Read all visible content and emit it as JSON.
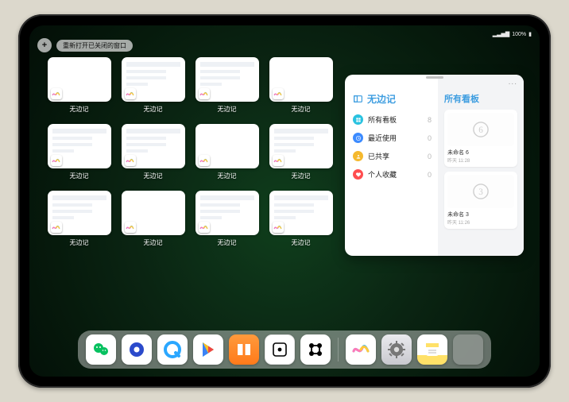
{
  "status": {
    "battery": "100%",
    "signal": "▂▃▅▇"
  },
  "top": {
    "add_label": "+",
    "reopen_label": "重新打开已关闭的窗口"
  },
  "switcher": {
    "app_name": "无边记",
    "cards": [
      {
        "label": "无边记",
        "style": "blank"
      },
      {
        "label": "无边记",
        "style": "detail"
      },
      {
        "label": "无边记",
        "style": "detail"
      },
      {
        "label": "无边记",
        "style": "blank"
      },
      {
        "label": "无边记",
        "style": "detail"
      },
      {
        "label": "无边记",
        "style": "detail"
      },
      {
        "label": "无边记",
        "style": "blank"
      },
      {
        "label": "无边记",
        "style": "detail"
      },
      {
        "label": "无边记",
        "style": "detail"
      },
      {
        "label": "无边记",
        "style": "blank"
      },
      {
        "label": "无边记",
        "style": "detail"
      },
      {
        "label": "无边记",
        "style": "detail"
      }
    ]
  },
  "freeform_window": {
    "title": "无边记",
    "sections": [
      {
        "icon": "grid",
        "color": "#29c2e0",
        "label": "所有看板",
        "count": "8"
      },
      {
        "icon": "clock",
        "color": "#3c8bff",
        "label": "最近使用",
        "count": "0"
      },
      {
        "icon": "people",
        "color": "#f5b92e",
        "label": "已共享",
        "count": "0"
      },
      {
        "icon": "heart",
        "color": "#ff4d4f",
        "label": "个人收藏",
        "count": "0"
      }
    ],
    "right_title": "所有看板",
    "boards": [
      {
        "name": "未命名 6",
        "meta": "昨天 11:28",
        "digit": "6"
      },
      {
        "name": "未命名 3",
        "meta": "昨天 11:26",
        "digit": "3"
      }
    ],
    "more": "..."
  },
  "dock": {
    "items": [
      {
        "id": "wechat",
        "name": "wechat-icon"
      },
      {
        "id": "q1",
        "name": "quark-icon"
      },
      {
        "id": "q2",
        "name": "qqbrowser-icon"
      },
      {
        "id": "play",
        "name": "play-store-icon"
      },
      {
        "id": "books",
        "name": "books-icon"
      },
      {
        "id": "notion",
        "name": "dice-icon"
      },
      {
        "id": "connect",
        "name": "connect-icon"
      },
      {
        "id": "freeform",
        "name": "freeform-icon"
      },
      {
        "id": "settings",
        "name": "settings-icon"
      },
      {
        "id": "notes",
        "name": "notes-icon"
      },
      {
        "id": "folder",
        "name": "app-folder-icon"
      }
    ]
  }
}
